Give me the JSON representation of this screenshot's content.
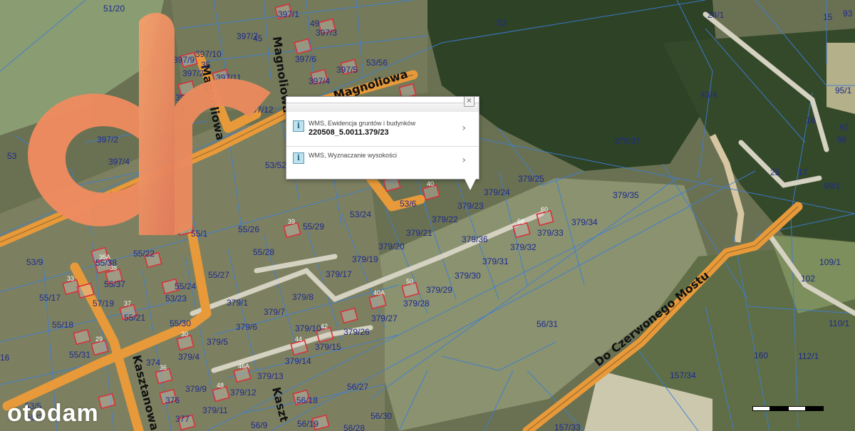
{
  "popup": {
    "close_label": "×",
    "rows": [
      {
        "title": "WMS, Ewidencja gruntów i budynków",
        "value": "220508_5.0011.379/23"
      },
      {
        "title": "WMS, Wyznaczanie wysokości",
        "value": ""
      }
    ]
  },
  "streets": [
    "Magnoliowa",
    "Magnoliowa",
    "Magnoliowa",
    "Kasztanowa",
    "Kaszt",
    "Do Czerwonego Mostu"
  ],
  "parcels": [
    "51/20",
    "397/1",
    "397/3",
    "49",
    "397/7",
    "45",
    "397/10",
    "397/9",
    "397/2",
    "397/6",
    "397/5",
    "397/4",
    "397/11",
    "397/13",
    "397/12",
    "35",
    "397/2",
    "397/8",
    "397/4",
    "52",
    "53/56",
    "24/1",
    "15",
    "93",
    "95/1",
    "43/4",
    "16",
    "97",
    "98",
    "379/37",
    "53/52",
    "379/25",
    "25",
    "17",
    "99/1",
    "379/24",
    "379/23",
    "379/35",
    "53/24",
    "379/22",
    "379/34",
    "53/6",
    "55/26",
    "55/29",
    "379/21",
    "379/36",
    "379/33",
    "379/32",
    "55/28",
    "379/20",
    "379/19",
    "379/31",
    "109/1",
    "53/9",
    "55/38",
    "55/22",
    "55/37",
    "55/27",
    "379/17",
    "379/30",
    "102",
    "55/17",
    "57/19",
    "53/23",
    "379/1",
    "379/8",
    "379/29",
    "379/28",
    "55/21",
    "379/7",
    "379/27",
    "56/31",
    "55/18",
    "55/30",
    "379/6",
    "379/10",
    "379/26",
    "110/1",
    "55/31",
    "379/5",
    "379/15",
    "379/4",
    "374",
    "379/14",
    "160",
    "112/1",
    "16",
    "379/13",
    "157/34",
    "379/9",
    "379/12",
    "56/27",
    "376",
    "56/18",
    "379/11",
    "377",
    "56/19",
    "56/9",
    "56/28",
    "56/30",
    "157/33",
    "53",
    "55/65",
    "55/24",
    "55/1",
    "35",
    "16",
    "53/5",
    "55/2"
  ],
  "buildings": [
    "40",
    "33",
    "46A",
    "44",
    "48",
    "42",
    "30",
    "29",
    "37",
    "40A",
    "50",
    "60",
    "58",
    "36",
    "35A",
    "38",
    "39"
  ],
  "watermark": "otodam",
  "colors": {
    "road": "#e89a3a",
    "popup_accent": "#bfe3ee",
    "parcel_label": "#1f2a8c",
    "parcel_line": "#3c7dd8",
    "building": "#d8303c"
  }
}
